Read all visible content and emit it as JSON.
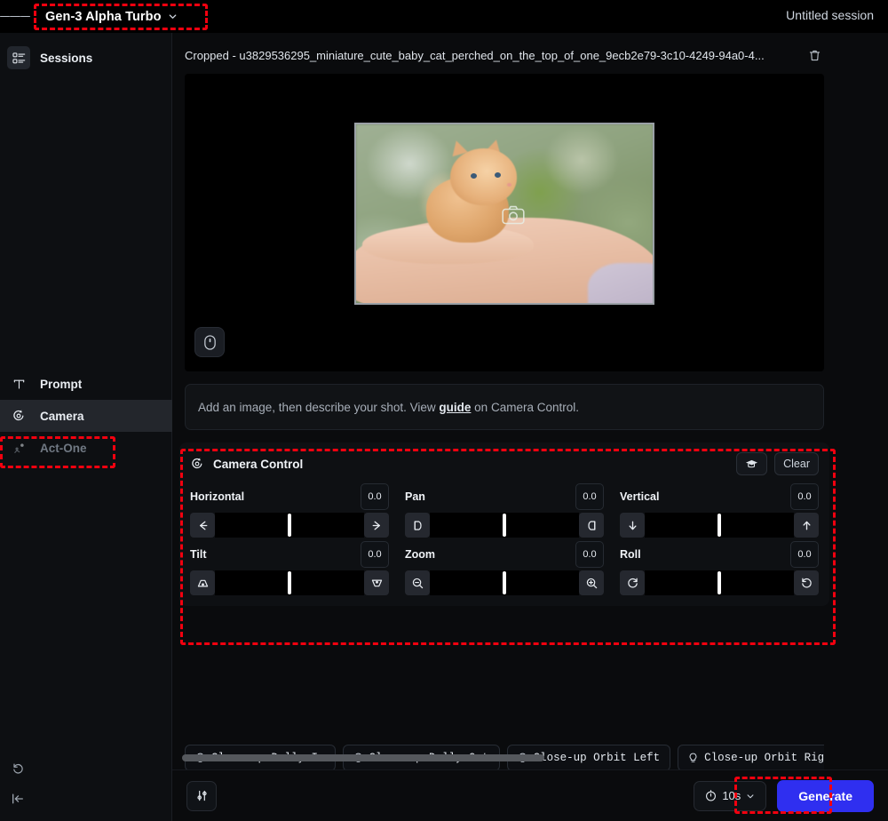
{
  "topbar": {
    "menu_icon": "hamburger-icon",
    "model": "Gen-3 Alpha Turbo",
    "model_chevron": "chevron-down-icon",
    "session": "Untitled session"
  },
  "sidebar": {
    "items": [
      {
        "label": "Sessions",
        "icon": "sessions-list-icon",
        "state": "default"
      },
      {
        "label": "Prompt",
        "icon": "text-t-icon",
        "state": "default"
      },
      {
        "label": "Camera",
        "icon": "camera-move-icon",
        "state": "active"
      },
      {
        "label": "Act-One",
        "icon": "act-one-person-icon",
        "state": "disabled"
      }
    ],
    "footer": [
      {
        "icon": "history-undo-icon"
      },
      {
        "icon": "collapse-panel-icon"
      }
    ]
  },
  "asset": {
    "title": "Cropped - u3829536295_miniature_cute_baby_cat_perched_on_the_top_of_one_9ecb2e79-3c10-4249-94a0-4...",
    "delete_icon": "trash-icon",
    "image_overlay_icon": "camera-icon",
    "scroll_hint_icon": "mouse-scroll-icon",
    "image_alt": "ginger kitten sitting on an open human hand, blurred green background"
  },
  "prompt": {
    "text_before": "Add an image, then describe your shot. View ",
    "link": "guide",
    "text_after": " on Camera Control."
  },
  "camera_control": {
    "title": "Camera Control",
    "title_icon": "camera-move-icon",
    "learn_icon": "graduation-cap-icon",
    "clear_label": "Clear",
    "controls": [
      {
        "label": "Horizontal",
        "value": "0.0",
        "left_icon": "arrow-left-icon",
        "right_icon": "arrow-right-icon",
        "thumb_pct": 50
      },
      {
        "label": "Pan",
        "value": "0.0",
        "left_icon": "pan-left-icon",
        "right_icon": "pan-right-icon",
        "thumb_pct": 50
      },
      {
        "label": "Vertical",
        "value": "0.0",
        "left_icon": "arrow-down-icon",
        "right_icon": "arrow-up-icon",
        "thumb_pct": 50
      },
      {
        "label": "Tilt",
        "value": "0.0",
        "left_icon": "tilt-up-icon",
        "right_icon": "tilt-down-icon",
        "thumb_pct": 50
      },
      {
        "label": "Zoom",
        "value": "0.0",
        "left_icon": "zoom-out-icon",
        "right_icon": "zoom-in-icon",
        "thumb_pct": 50
      },
      {
        "label": "Roll",
        "value": "0.0",
        "left_icon": "roll-left-icon",
        "right_icon": "roll-right-icon",
        "thumb_pct": 50
      }
    ]
  },
  "presets": {
    "icon": "lightbulb-icon",
    "items": [
      "Close-up Dolly In",
      "Close-up Dolly Out",
      "Close-up Orbit Left",
      "Close-up Orbit Right"
    ]
  },
  "bottombar": {
    "settings_icon": "sliders-icon",
    "duration_icon": "clock-icon",
    "duration": "10s",
    "duration_chevron": "chevron-down-icon",
    "generate_label": "Generate"
  },
  "colors": {
    "accent_blue": "#2f2ff0",
    "annotation_red": "#f2000f",
    "background": "#000000",
    "panel": "#0e1013",
    "sidebar": "#0d0f12"
  }
}
